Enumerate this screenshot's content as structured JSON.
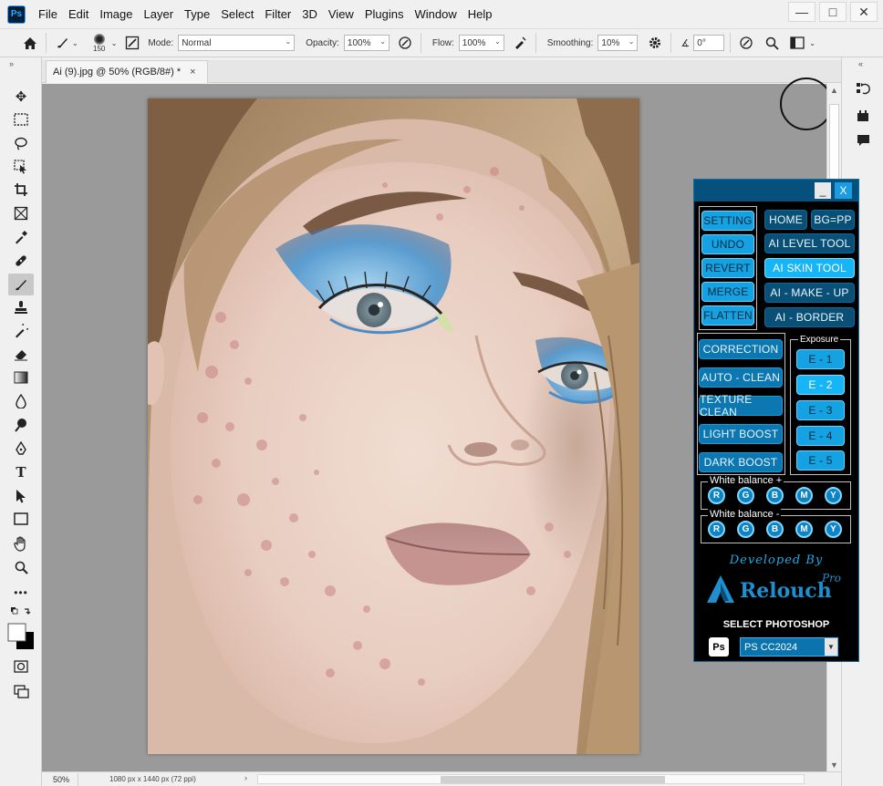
{
  "menubar": {
    "logo": "Ps",
    "items": [
      "File",
      "Edit",
      "Image",
      "Layer",
      "Type",
      "Select",
      "Filter",
      "3D",
      "View",
      "Plugins",
      "Window",
      "Help"
    ],
    "controls": {
      "minimize": "—",
      "maximize": "□",
      "close": "✕"
    }
  },
  "options": {
    "brush_size": "150",
    "mode_label": "Mode:",
    "mode_value": "Normal",
    "opacity_label": "Opacity:",
    "opacity_value": "100%",
    "flow_label": "Flow:",
    "flow_value": "100%",
    "smoothing_label": "Smoothing:",
    "smoothing_value": "10%",
    "angle_value": "0°"
  },
  "document": {
    "tab_title": "Ai (9).jpg @ 50% (RGB/8#) *",
    "tab_close": "×",
    "zoom": "50%",
    "info": "1080 px x 1440 px (72 ppi)"
  },
  "panel": {
    "min": "_",
    "close": "X",
    "left_buttons": [
      "SETTING",
      "UNDO",
      "REVERT",
      "MERGE",
      "FLATTEN"
    ],
    "right_buttons": {
      "home": "HOME",
      "bgpp": "BG=PP",
      "level": "AI LEVEL TOOL",
      "skin": "AI SKIN TOOL",
      "makeup": "AI - MAKE - UP",
      "border": "AI - BORDER"
    },
    "tools": [
      "CORRECTION",
      "AUTO - CLEAN",
      "TEXTURE CLEAN",
      "LIGHT BOOST",
      "DARK  BOOST"
    ],
    "exposure_label": "Exposure",
    "exposure": [
      "E - 1",
      "E - 2",
      "E - 3",
      "E - 4",
      "E - 5"
    ],
    "wb_plus_label": "White balance +",
    "wb_minus_label": "White balance -",
    "wb_channels": [
      "R",
      "G",
      "B",
      "M",
      "Y"
    ],
    "developed_by": "Developed By",
    "brand": "Relouch",
    "brand_suffix": "Pro",
    "select_label": "SELECT PHOTOSHOP",
    "ps_badge": "Ps",
    "ps_version": "PS CC2024"
  }
}
